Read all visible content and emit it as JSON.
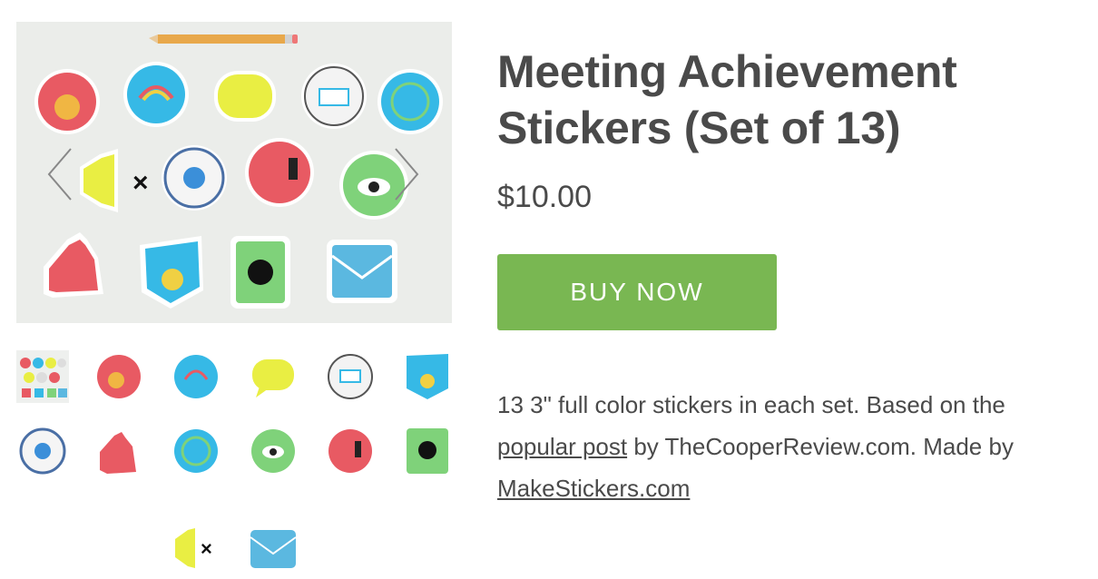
{
  "product": {
    "title": "Meeting Achievement Stickers (Set of 13)",
    "price": "$10.00",
    "buy_label": "BUY NOW",
    "description": {
      "part1": "13 3\" full color stickers in each set. Based on the ",
      "link1": "popular post",
      "part2": " by TheCooperReview.com. Made by ",
      "link2": "MakeStickers.com"
    }
  },
  "gallery": {
    "prev_icon": "chevron-left-icon",
    "next_icon": "chevron-right-icon",
    "thumbnails": [
      "all-stickers-photo",
      "showed-up",
      "had-a-vague-idea",
      "didnt-offend-anyone",
      "successfully-projected-my-screen",
      "responded-convincingly",
      "checked-facebook-no-one-noticed",
      "backed-up-my-bff",
      "knew-the-acronym",
      "stayed-awake",
      "no-action-items-assigned-to-me",
      "held-in-a-fart",
      "used-mute-button",
      "next-update-will-be-by-email"
    ]
  },
  "colors": {
    "accent": "#79b752",
    "text": "#4a4a4a",
    "red": "#e85a63",
    "blue": "#36b9e6",
    "green": "#7fd27a",
    "yellow": "#e9ee43"
  }
}
